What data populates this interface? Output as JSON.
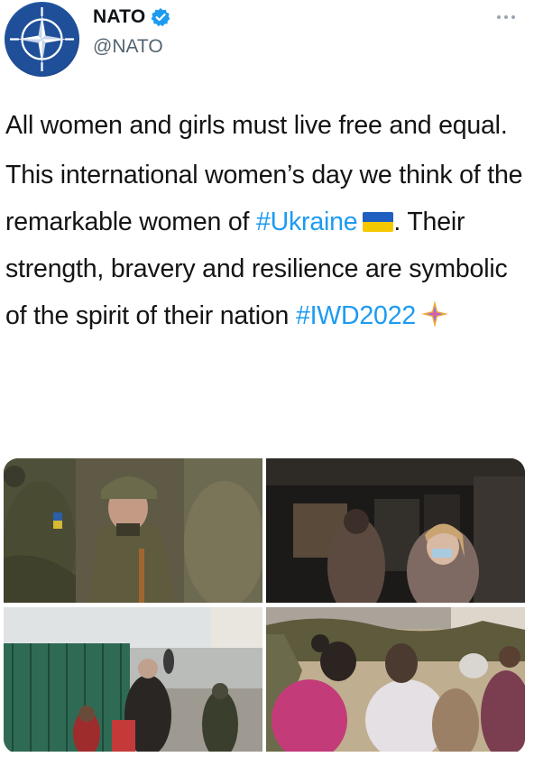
{
  "tweet": {
    "author": {
      "display_name": "NATO",
      "handle": "@NATO",
      "verified": true,
      "avatar_icon": "nato-compass-star-icon"
    },
    "more_icon": "more-dots-icon",
    "paragraph_1": "All women and girls must live free and equal.",
    "p2_line_1": "This international women’s day we think of the remarkable women of ",
    "hashtag_ukraine": "#Ukraine",
    "flag_icon": "ukraine-flag-icon",
    "p2_line_2": ". Their strength, bravery and resilience are symbolic of the spirit of their nation ",
    "hashtag_iwd": "#IWD2022",
    "sparkle_icon": "iwd-sparkle-icon"
  },
  "media": {
    "photos": [
      {
        "name": "photo-soldiers",
        "icon": "image"
      },
      {
        "name": "photo-corridor",
        "icon": "image"
      },
      {
        "name": "photo-border-walk",
        "icon": "image"
      },
      {
        "name": "photo-camouflage-net",
        "icon": "image"
      }
    ]
  },
  "colors": {
    "link": "#1d9bf0",
    "text": "#0f1419",
    "secondary": "#536471",
    "verified": "#1d9bf0",
    "nato_blue": "#1f4f99"
  }
}
